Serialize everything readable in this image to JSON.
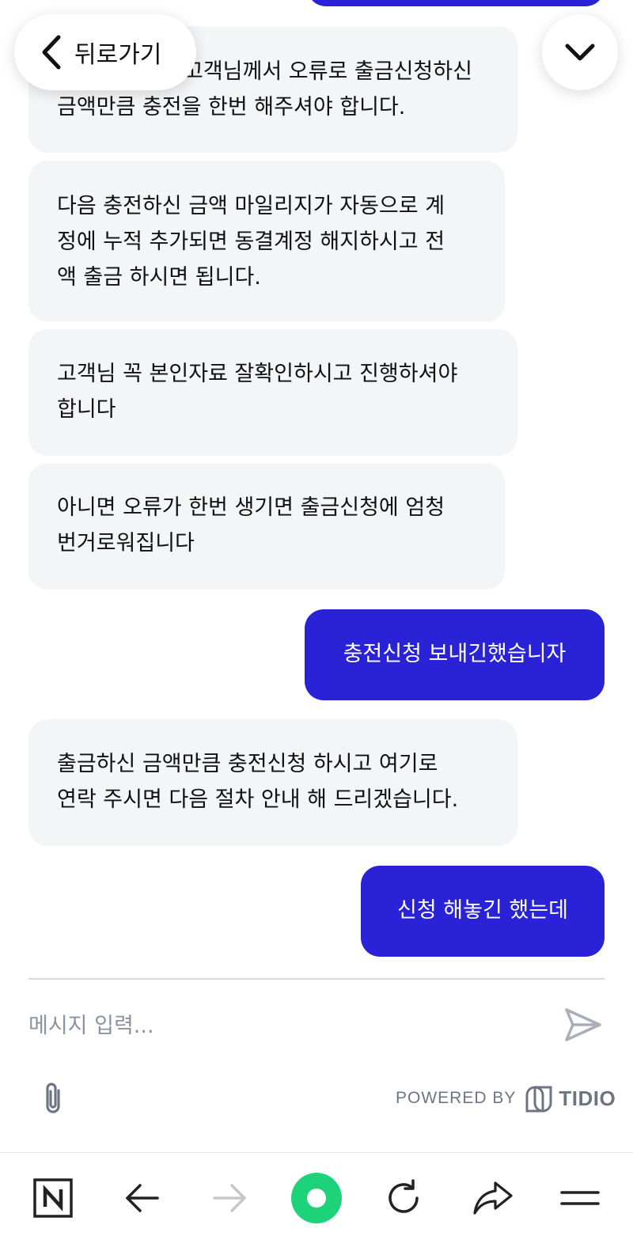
{
  "header": {
    "back_label": "뒤로가기",
    "back_icon": "chevron-left-icon",
    "minimize_icon": "chevron-down-icon"
  },
  "messages": [
    {
      "from": "operator",
      "lines": [
        "고객님께서 오류로 출금신청하신",
        "금액만큼 충전을 한번 해주셔야 합니다."
      ]
    },
    {
      "from": "operator",
      "lines": [
        "다음 충전하신 금액 마일리지가 자동으로 계",
        "정에 누적 추가되면 동결계정 해지하시고 전",
        "액 출금 하시면 됩니다."
      ]
    },
    {
      "from": "operator",
      "lines": [
        "고객님 꼭 본인자료 잘확인하시고 진행하셔야",
        "합니다"
      ]
    },
    {
      "from": "operator",
      "lines": [
        "아니면 오류가 한번 생기면 출금신청에 엄청",
        "번거로워집니다"
      ]
    },
    {
      "from": "visitor",
      "lines": [
        "충전신청 보내긴했습니자"
      ]
    },
    {
      "from": "operator",
      "lines": [
        "출금하신 금액만큼 충전신청 하시고 여기로",
        "연락 주시면 다음 절차 안내 해 드리겠습니다."
      ]
    },
    {
      "from": "visitor",
      "lines": [
        "신청 해놓긴 했는데"
      ]
    }
  ],
  "composer": {
    "placeholder": "메시지 입력...",
    "send_icon": "send-icon",
    "attach_icon": "paperclip-icon"
  },
  "branding": {
    "powered_by": "POWERED BY",
    "brand": "TIDIO"
  },
  "browser_nav": {
    "items": [
      "naver-n-icon",
      "back-arrow-icon",
      "forward-arrow-icon",
      "green-dot-home-icon",
      "refresh-icon",
      "share-icon",
      "menu-icon"
    ]
  },
  "colors": {
    "visitor_bubble": "#2a22d6",
    "operator_bubble": "#f4f5f7",
    "accent_green": "#1ed27a"
  }
}
